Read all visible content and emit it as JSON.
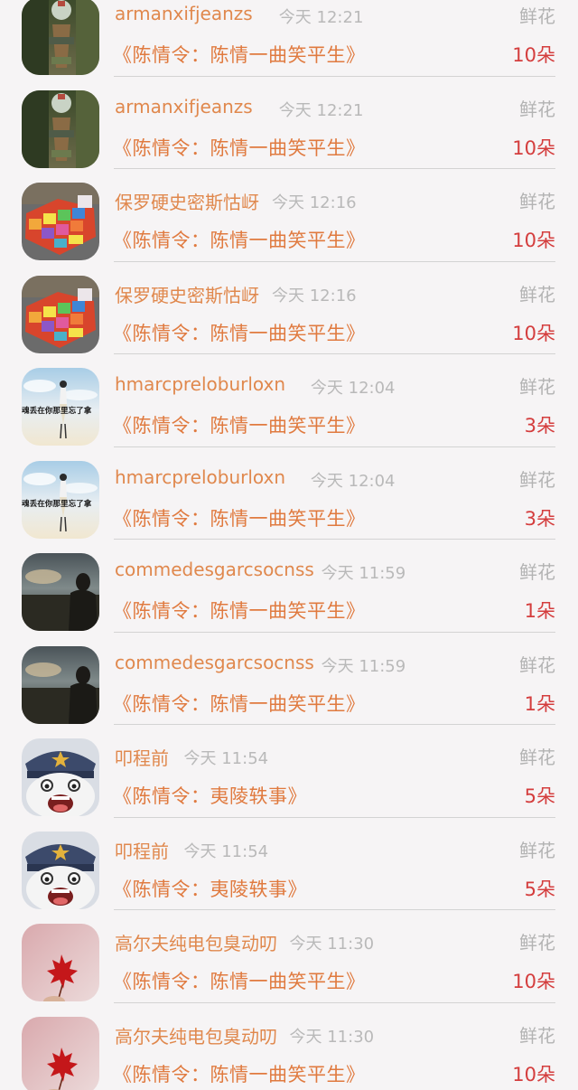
{
  "colors": {
    "background": "#f6f4f5",
    "username": "#e0884d",
    "title": "#e07a3f",
    "count": "#d43d3d",
    "time": "#b9b9b9",
    "gift": "#b3b3b3"
  },
  "rows": [
    {
      "avatar": "lantern",
      "user": "armanxifjeanzs",
      "time": "今天 12:21",
      "gift": "鲜花",
      "title": "《陈情令：陈情一曲笑平生》",
      "count": "10朵"
    },
    {
      "avatar": "lantern",
      "user": "armanxifjeanzs",
      "time": "今天 12:21",
      "gift": "鲜花",
      "title": "《陈情令：陈情一曲笑平生》",
      "count": "10朵"
    },
    {
      "avatar": "rainbow-cubes",
      "user": "保罗硬史密斯怙岈",
      "time": "今天 12:16",
      "gift": "鲜花",
      "title": "《陈情令：陈情一曲笑平生》",
      "count": "10朵"
    },
    {
      "avatar": "rainbow-cubes",
      "user": "保罗硬史密斯怙岈",
      "time": "今天 12:16",
      "gift": "鲜花",
      "title": "《陈情令：陈情一曲笑平生》",
      "count": "10朵"
    },
    {
      "avatar": "sky-figure",
      "user": "hmarcpreloburloxn",
      "time": "今天 12:04",
      "gift": "鲜花",
      "title": "《陈情令：陈情一曲笑平生》",
      "count": "3朵",
      "avatar_text": "魂丢在你那里忘了拿"
    },
    {
      "avatar": "sky-figure",
      "user": "hmarcpreloburloxn",
      "time": "今天 12:04",
      "gift": "鲜花",
      "title": "《陈情令：陈情一曲笑平生》",
      "count": "3朵",
      "avatar_text": "魂丢在你那里忘了拿"
    },
    {
      "avatar": "dusk-portrait",
      "user": "commedesgarcsocnss",
      "time": "今天 11:59",
      "gift": "鲜花",
      "title": "《陈情令：陈情一曲笑平生》",
      "count": "1朵"
    },
    {
      "avatar": "dusk-portrait",
      "user": "commedesgarcsocnss",
      "time": "今天 11:59",
      "gift": "鲜花",
      "title": "《陈情令：陈情一曲笑平生》",
      "count": "1朵"
    },
    {
      "avatar": "cartoon-bear-police",
      "user": "叩程前",
      "time": "今天 11:54",
      "gift": "鲜花",
      "title": "《陈情令：夷陵轶事》",
      "count": "5朵"
    },
    {
      "avatar": "cartoon-bear-police",
      "user": "叩程前",
      "time": "今天 11:54",
      "gift": "鲜花",
      "title": "《陈情令：夷陵轶事》",
      "count": "5朵"
    },
    {
      "avatar": "maple-leaf",
      "user": "高尔夫纯电包臭动叨",
      "time": "今天 11:30",
      "gift": "鲜花",
      "title": "《陈情令：陈情一曲笑平生》",
      "count": "10朵"
    },
    {
      "avatar": "maple-leaf",
      "user": "高尔夫纯电包臭动叨",
      "time": "今天 11:30",
      "gift": "鲜花",
      "title": "《陈情令：陈情一曲笑平生》",
      "count": "10朵"
    }
  ]
}
